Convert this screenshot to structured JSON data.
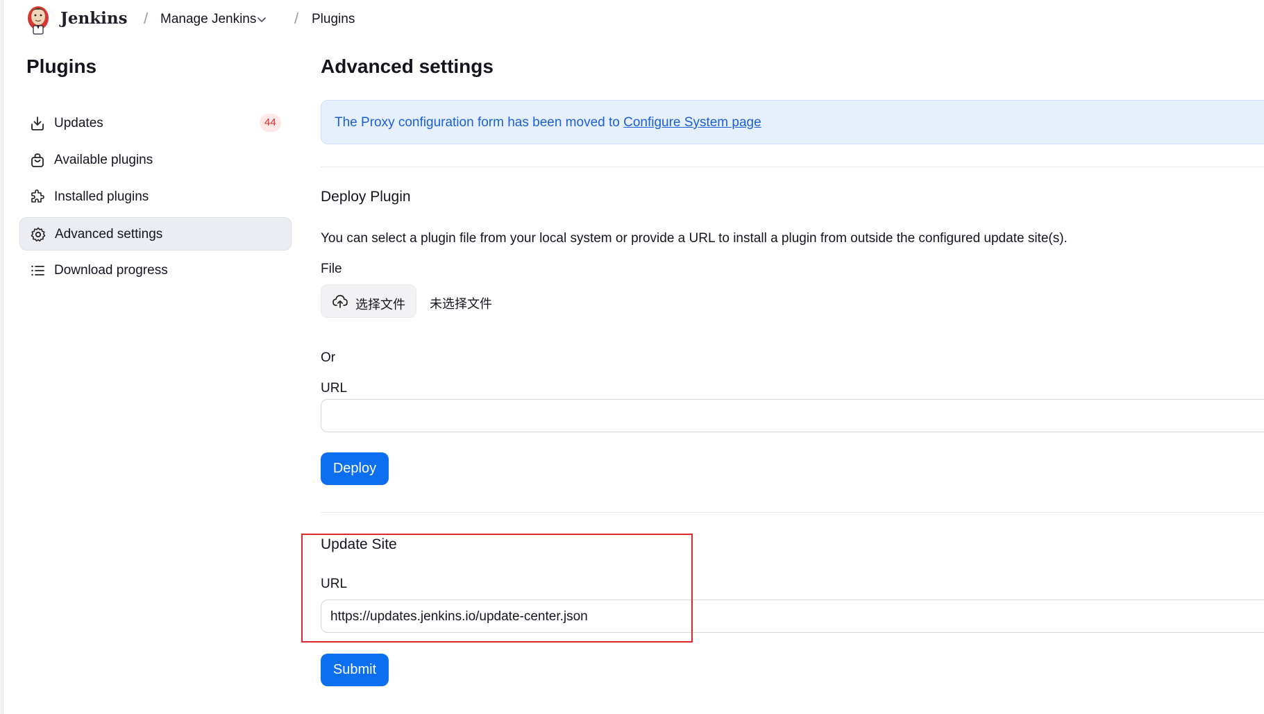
{
  "header": {
    "brand": "Jenkins",
    "breadcrumb": [
      "Manage Jenkins",
      "Plugins"
    ],
    "separator": "/",
    "dropdown_icon": "chevron-down-icon"
  },
  "sidebar": {
    "title": "Plugins",
    "items": [
      {
        "label": "Updates",
        "icon": "download-icon",
        "badge": "44"
      },
      {
        "label": "Available plugins",
        "icon": "shopping-bag-icon"
      },
      {
        "label": "Installed plugins",
        "icon": "puzzle-icon"
      },
      {
        "label": "Advanced settings",
        "icon": "gear-icon",
        "active": true
      },
      {
        "label": "Download progress",
        "icon": "list-icon"
      }
    ]
  },
  "main": {
    "title": "Advanced settings",
    "notice": {
      "text": "The Proxy configuration form has been moved to ",
      "link": "Configure System page"
    },
    "deploy": {
      "title": "Deploy Plugin",
      "description": "You can select a plugin file from your local system or provide a URL to install a plugin from outside the configured update site(s).",
      "file_label": "File",
      "file_button": "选择文件",
      "file_status": "未选择文件",
      "or_label": "Or",
      "url_label": "URL",
      "url_value": "",
      "button": "Deploy"
    },
    "update_site": {
      "title": "Update Site",
      "url_label": "URL",
      "url_value": "https://updates.jenkins.io/update-center.json",
      "button": "Submit"
    }
  },
  "colors": {
    "primary": "#0b6ff0",
    "notice_bg": "#e6f0fd",
    "notice_text": "#1a5fd6",
    "badge_bg": "#fde7e7",
    "badge_text": "#e0262a",
    "highlight": "#e0262a"
  }
}
